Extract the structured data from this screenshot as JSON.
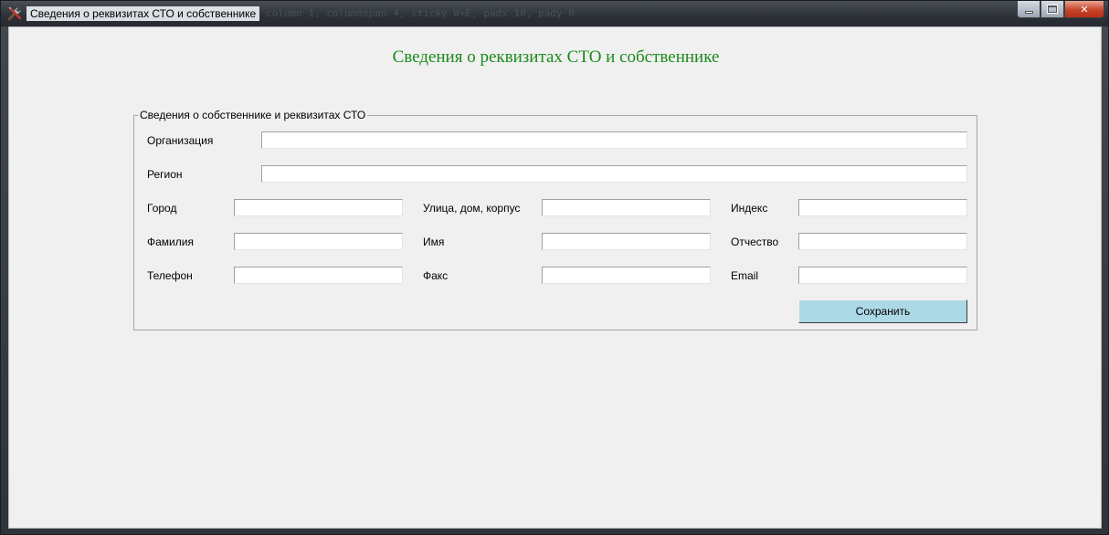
{
  "window": {
    "title": "Сведения о реквизитах СТО и собственнике",
    "background_code": "column 1, columnspan 4, sticky W+E, padx 10, pady 0",
    "controls": {
      "minimize": "",
      "maximize": "",
      "close": "✕"
    }
  },
  "heading": "Сведения о реквизитах СТО и собственнике",
  "heading_color": "#1a8a1a",
  "group": {
    "legend": "Сведения о собственнике и реквизитах СТО",
    "fields": {
      "organization": {
        "label": "Организация",
        "value": ""
      },
      "region": {
        "label": "Регион",
        "value": ""
      },
      "city": {
        "label": "Город",
        "value": ""
      },
      "street": {
        "label": "Улица, дом, корпус",
        "value": ""
      },
      "index": {
        "label": "Индекс",
        "value": ""
      },
      "surname": {
        "label": "Фамилия",
        "value": ""
      },
      "name": {
        "label": "Имя",
        "value": ""
      },
      "patronymic": {
        "label": "Отчество",
        "value": ""
      },
      "phone": {
        "label": "Телефон",
        "value": ""
      },
      "fax": {
        "label": "Факс",
        "value": ""
      },
      "email": {
        "label": "Email",
        "value": ""
      }
    },
    "save_label": "Сохранить",
    "save_color": "#add8e6"
  },
  "icons": {
    "app": "tools-icon"
  }
}
